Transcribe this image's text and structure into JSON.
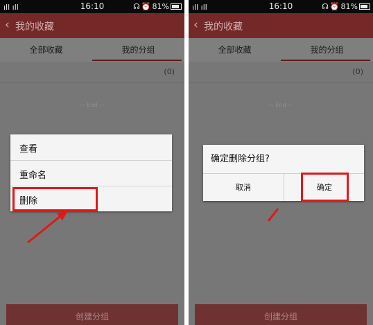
{
  "status_bar": {
    "signal_text": "ıll ıll",
    "time": "16:10",
    "battery": "81%"
  },
  "nav": {
    "title": "我的收藏"
  },
  "tabs": [
    {
      "label": "全部收藏",
      "active": false
    },
    {
      "label": "我的分组",
      "active": true
    }
  ],
  "list": {
    "count": "(0)",
    "end_text": "— End —"
  },
  "bottom_button": "创建分组",
  "context_menu": {
    "items": [
      "查看",
      "重命名",
      "删除"
    ]
  },
  "confirm_dialog": {
    "message": "确定删除分组?",
    "cancel_label": "取消",
    "ok_label": "确定"
  },
  "colors": {
    "header": "#752828",
    "highlight": "#e01818",
    "overlay": "#777777"
  },
  "icons": [
    "back-arrow-icon",
    "wifi-icon",
    "alarm-icon",
    "battery-icon",
    "pointer-arrow-icon"
  ]
}
